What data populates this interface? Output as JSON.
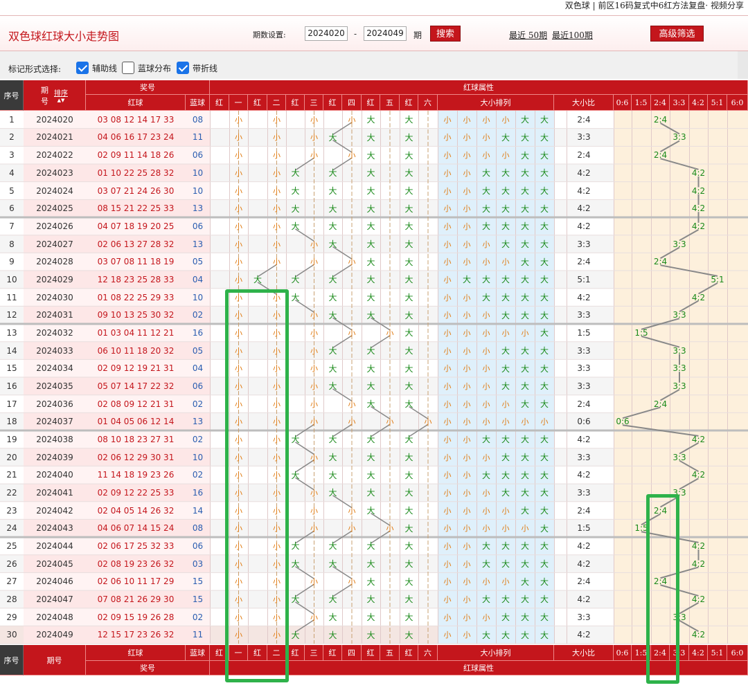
{
  "top_text": "双色球 | 前区16码复式中6红方法复盘· 视频分享",
  "header": {
    "title": "双色球红球大小走势图",
    "period_label": "期数设置:",
    "from": "2024020",
    "dash": "-",
    "to": "2024049",
    "period_unit": "期",
    "search": "搜索",
    "recent50": "最近 50期",
    "recent100": "最近100期",
    "advanced": "高级筛选"
  },
  "options": {
    "label": "标记形式选择:",
    "items": [
      {
        "label": "辅助线",
        "checked": true
      },
      {
        "label": "蓝球分布",
        "checked": false
      },
      {
        "label": "带折线",
        "checked": true
      }
    ]
  },
  "headers": {
    "seq": "序号",
    "period_a": "期",
    "period_b": "号",
    "sort": "排序",
    "prize": "奖号",
    "red": "红球",
    "blue": "蓝球",
    "attr": "红球属性",
    "pos": [
      "红",
      "一",
      "红",
      "二",
      "红",
      "三",
      "红",
      "四",
      "红",
      "五",
      "红",
      "六"
    ],
    "size_order": "大小排列",
    "ratio": "大小比",
    "ratios": [
      "0:6",
      "1:5",
      "2:4",
      "3:3",
      "4:2",
      "5:1",
      "6:0"
    ],
    "period_full": "期号"
  },
  "rows": [
    {
      "n": "1",
      "p": "2024020",
      "r": "03 08 12 14 17 33",
      "b": "08",
      "ratio": "2:4"
    },
    {
      "n": "2",
      "p": "2024021",
      "r": "04 06 16 17 23 24",
      "b": "11",
      "ratio": "3:3"
    },
    {
      "n": "3",
      "p": "2024022",
      "r": "02 09 11 14 18 26",
      "b": "06",
      "ratio": "2:4"
    },
    {
      "n": "4",
      "p": "2024023",
      "r": "01 10 22 25 28 32",
      "b": "10",
      "ratio": "4:2"
    },
    {
      "n": "5",
      "p": "2024024",
      "r": "03 07 21 24 26 30",
      "b": "10",
      "ratio": "4:2"
    },
    {
      "n": "6",
      "p": "2024025",
      "r": "08 15 21 22 25 33",
      "b": "13",
      "ratio": "4:2"
    },
    {
      "n": "7",
      "p": "2024026",
      "r": "04 07 18 19 20 25",
      "b": "06",
      "ratio": "4:2"
    },
    {
      "n": "8",
      "p": "2024027",
      "r": "02 06 13 27 28 32",
      "b": "13",
      "ratio": "3:3"
    },
    {
      "n": "9",
      "p": "2024028",
      "r": "03 07 08 11 18 19",
      "b": "05",
      "ratio": "2:4"
    },
    {
      "n": "10",
      "p": "2024029",
      "r": "12 18 23 25 28 33",
      "b": "04",
      "ratio": "5:1"
    },
    {
      "n": "11",
      "p": "2024030",
      "r": "01 08 22 25 29 33",
      "b": "10",
      "ratio": "4:2"
    },
    {
      "n": "12",
      "p": "2024031",
      "r": "09 10 13 25 30 32",
      "b": "02",
      "ratio": "3:3"
    },
    {
      "n": "13",
      "p": "2024032",
      "r": "01 03 04 11 12 21",
      "b": "16",
      "ratio": "1:5"
    },
    {
      "n": "14",
      "p": "2024033",
      "r": "06 10 11 18 20 32",
      "b": "05",
      "ratio": "3:3"
    },
    {
      "n": "15",
      "p": "2024034",
      "r": "02 09 12 19 21 31",
      "b": "04",
      "ratio": "3:3"
    },
    {
      "n": "16",
      "p": "2024035",
      "r": "05 07 14 17 22 32",
      "b": "06",
      "ratio": "3:3"
    },
    {
      "n": "17",
      "p": "2024036",
      "r": "02 08 09 12 21 31",
      "b": "02",
      "ratio": "2:4"
    },
    {
      "n": "18",
      "p": "2024037",
      "r": "01 04 05 06 12 14",
      "b": "13",
      "ratio": "0:6"
    },
    {
      "n": "19",
      "p": "2024038",
      "r": "08 10 18 23 27 31",
      "b": "02",
      "ratio": "4:2"
    },
    {
      "n": "20",
      "p": "2024039",
      "r": "02 06 12 29 30 31",
      "b": "10",
      "ratio": "3:3"
    },
    {
      "n": "21",
      "p": "2024040",
      "r": "11 14 18 19 23 26",
      "b": "02",
      "ratio": "4:2"
    },
    {
      "n": "22",
      "p": "2024041",
      "r": "02 09 12 22 25 33",
      "b": "16",
      "ratio": "3:3"
    },
    {
      "n": "23",
      "p": "2024042",
      "r": "02 04 05 14 26 32",
      "b": "14",
      "ratio": "2:4"
    },
    {
      "n": "24",
      "p": "2024043",
      "r": "04 06 07 14 15 24",
      "b": "08",
      "ratio": "1:5"
    },
    {
      "n": "25",
      "p": "2024044",
      "r": "02 06 17 25 32 33",
      "b": "06",
      "ratio": "4:2"
    },
    {
      "n": "26",
      "p": "2024045",
      "r": "02 08 19 23 26 32",
      "b": "03",
      "ratio": "4:2"
    },
    {
      "n": "27",
      "p": "2024046",
      "r": "02 06 10 11 17 29",
      "b": "15",
      "ratio": "2:4"
    },
    {
      "n": "28",
      "p": "2024047",
      "r": "07 08 21 26 29 30",
      "b": "15",
      "ratio": "4:2"
    },
    {
      "n": "29",
      "p": "2024048",
      "r": "02 09 15 19 26 28",
      "b": "02",
      "ratio": "3:3"
    },
    {
      "n": "30",
      "p": "2024049",
      "r": "12 15 17 23 26 32",
      "b": "11",
      "ratio": "4:2"
    }
  ],
  "small_char": "小",
  "big_char": "大",
  "colors": {
    "red": "#c4161c",
    "dark": "#3a3a3a",
    "green_box": "#2eb24a",
    "ratio_bg": "#fdf0dc",
    "sort_bg": "#dff0fb"
  }
}
